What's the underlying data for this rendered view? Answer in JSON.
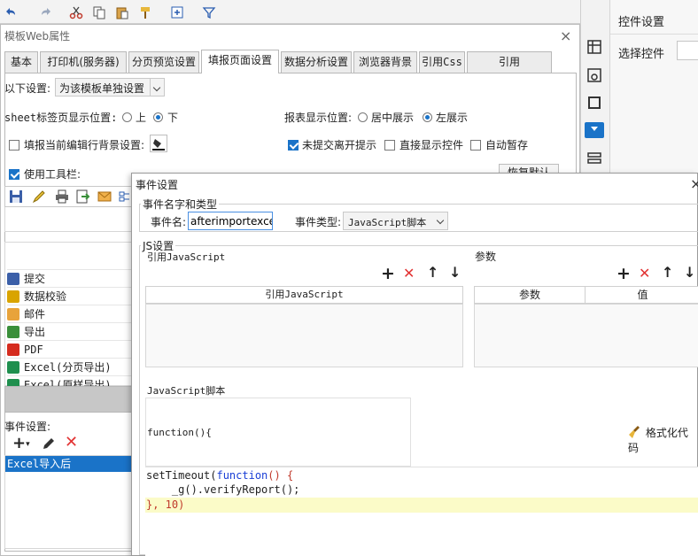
{
  "main_dialog": {
    "title": "模板Web属性",
    "close_glyph": "×",
    "tabs": [
      {
        "label": "基本"
      },
      {
        "label": "打印机(服务器)"
      },
      {
        "label": "分页预览设置"
      },
      {
        "label": "填报页面设置",
        "active": true
      },
      {
        "label": "数据分析设置"
      },
      {
        "label": "浏览器背景"
      },
      {
        "label": "引用Css"
      },
      {
        "label": "引用JavaScript"
      }
    ],
    "settings_label": "以下设置:",
    "settings_select": "为该模板单独设置",
    "sheet_pos_label": "sheet标签页显示位置:",
    "sheet_pos_options": [
      "上",
      "下"
    ],
    "sheet_pos_selected": 1,
    "report_pos_label": "报表显示位置:",
    "report_pos_options": [
      "居中展示",
      "左展示"
    ],
    "report_pos_selected": 1,
    "fill_bg_label": "填报当前编辑行背景设置:",
    "fill_bg_checked": false,
    "unsubmitted_label": "未提交离开提示",
    "unsubmitted_checked": true,
    "show_widget_label": "直接显示控件",
    "show_widget_checked": false,
    "autosave_label": "自动暂存",
    "autosave_checked": false,
    "use_toolbar_label": "使用工具栏:",
    "use_toolbar_checked": true,
    "restore_default_label": "恢复默认",
    "buttons": [
      {
        "label": "提交",
        "icon": "save-icon",
        "color": "#3b5fa8"
      },
      {
        "label": "数据校验",
        "icon": "check-pencil-icon",
        "color": "#d9a400"
      },
      {
        "label": "邮件",
        "icon": "mail-icon",
        "color": "#e8a33b"
      },
      {
        "label": "导出",
        "icon": "export-icon",
        "color": "#3a8f3a"
      },
      {
        "label": "PDF",
        "icon": "pdf-icon",
        "color": "#d52b1e"
      },
      {
        "label": "Excel(分页导出)",
        "icon": "excel-icon",
        "color": "#1f8f4e"
      },
      {
        "label": "Excel(原样导出)",
        "icon": "excel-icon",
        "color": "#1f8f4e"
      }
    ],
    "event_settings_label": "事件设置:",
    "event_items": [
      "Excel导入后"
    ]
  },
  "right_panel": {
    "title": "控件设置",
    "select_label": "选择控件"
  },
  "event_dialog": {
    "title": "事件设置",
    "close_glyph": "×",
    "name_type_legend": "事件名字和类型",
    "event_name_label": "事件名:",
    "event_name_value": "afterimportexcel",
    "event_type_label": "事件类型:",
    "event_type_value": "JavaScript脚本",
    "js_legend": "JS设置",
    "ref_js_label": "引用JavaScript",
    "ref_js_col": "引用JavaScript",
    "params_label": "参数",
    "params_cols": [
      "参数",
      "值"
    ],
    "script_label": "JavaScript脚本",
    "function_header": "function(){",
    "format_code_label": "格式化代码",
    "code_lines": [
      {
        "plain": "setTimeout(",
        "kw": "function",
        "rest": "() {"
      },
      {
        "plain": "    _g().verifyReport();",
        "kw": "",
        "rest": ""
      },
      {
        "plain": "}, 10)",
        "kw": "",
        "rest": ""
      }
    ],
    "colors": {
      "keyword": "#1a3fd6",
      "paren": "#c0392b",
      "highlight": "#fbfbc8",
      "number": "#2b7a2b"
    }
  }
}
